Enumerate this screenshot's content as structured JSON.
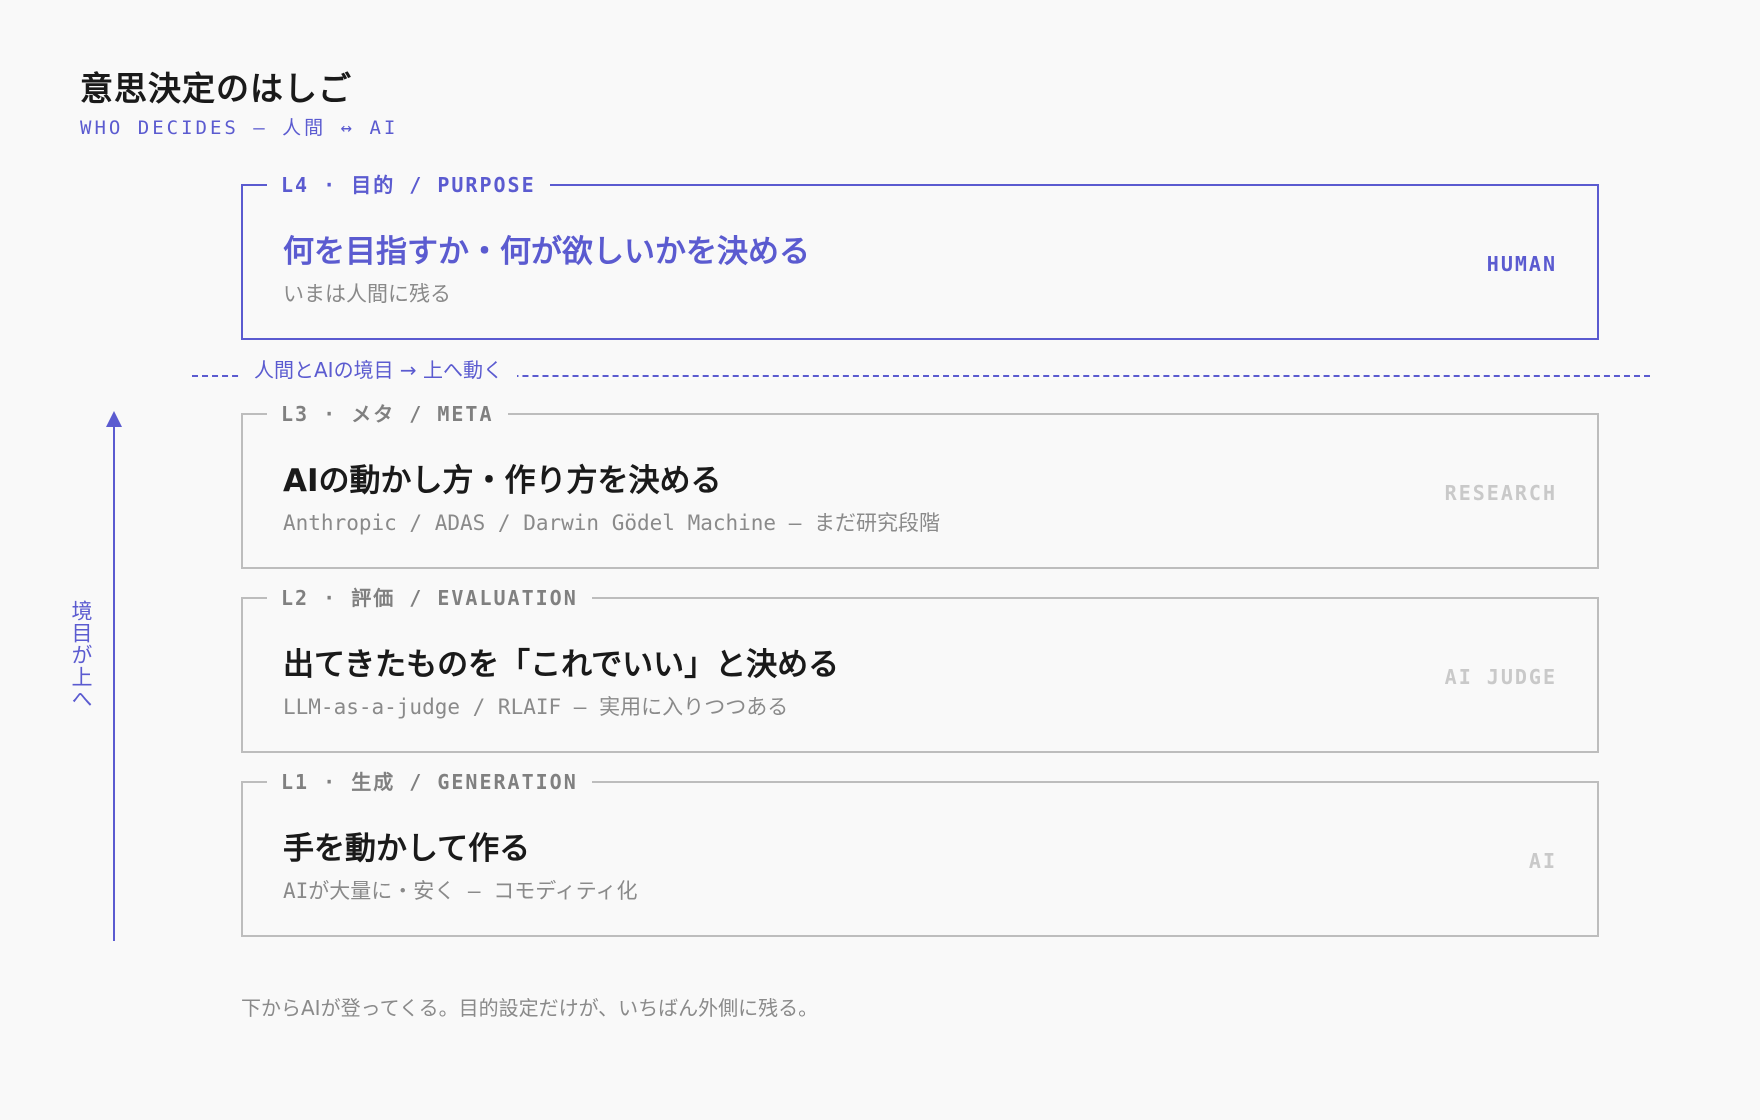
{
  "header": {
    "title": "意思決定のはしご",
    "subtitle": "WHO DECIDES — 人間 ↔ AI"
  },
  "levels": [
    {
      "tag": "L4 · 目的 / PURPOSE",
      "heading": "何を目指すか・何が欲しいかを決める",
      "description": "いまは人間に残る",
      "actor": "HUMAN"
    },
    {
      "tag": "L3 · メタ / META",
      "heading": "AIの動かし方・作り方を決める",
      "description": "Anthropic / ADAS / Darwin Gödel Machine — まだ研究段階",
      "actor": "RESEARCH"
    },
    {
      "tag": "L2 · 評価 / EVALUATION",
      "heading": "出てきたものを「これでいい」と決める",
      "description": "LLM-as-a-judge / RLAIF — 実用に入りつつある",
      "actor": "AI JUDGE"
    },
    {
      "tag": "L1 · 生成 / GENERATION",
      "heading": "手を動かして作る",
      "description": "AIが大量に・安く — コモディティ化",
      "actor": "AI"
    }
  ],
  "boundary": {
    "label": "人間とAIの境目 → 上へ動く"
  },
  "side_axis": {
    "label": "境目が上へ"
  },
  "footnote": "下からAIが登ってくる。目的設定だけが、いちばん外側に残る。",
  "colors": {
    "accent": "#5b5bd0",
    "border": "#bdbdbd",
    "muted": "#8a8a8a",
    "faint": "#c9c9c9",
    "background": "#f9f9f9"
  }
}
